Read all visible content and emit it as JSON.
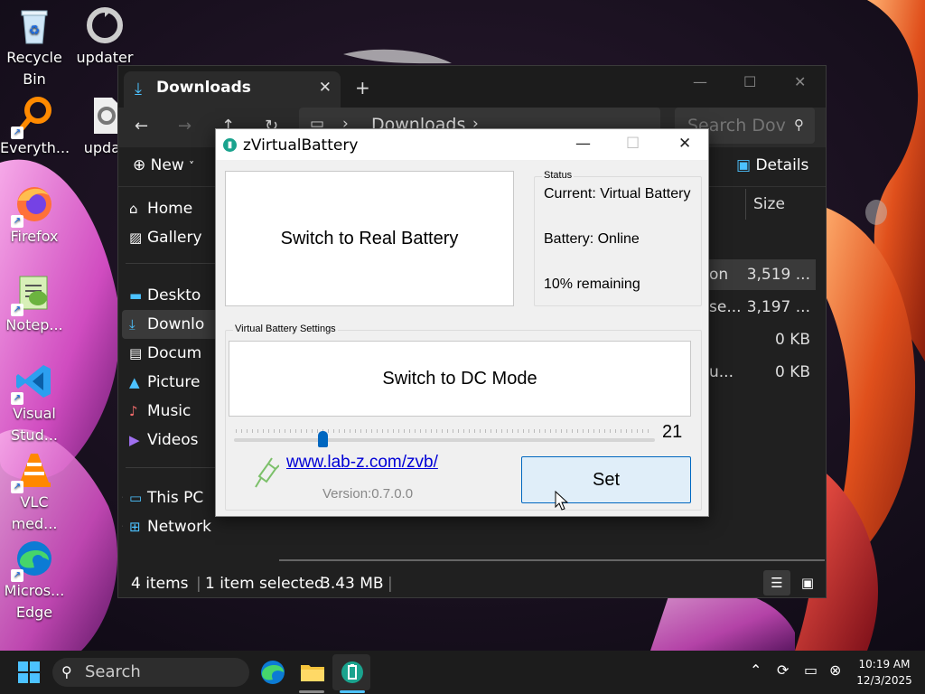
{
  "desktop": {
    "icons": [
      {
        "label": "Recycle\nBin",
        "icon": "recycle-bin-icon"
      },
      {
        "label": "updater",
        "icon": "updater-icon"
      },
      {
        "label": "Everyth...",
        "icon": "everything-search-icon"
      },
      {
        "label": "updat",
        "icon": "gear-file-icon"
      },
      {
        "label": "Firefox",
        "icon": "firefox-icon"
      },
      {
        "label": "Notep...",
        "icon": "notepad-plus-plus-icon"
      },
      {
        "label": "Visual\nStud...",
        "icon": "vscode-icon"
      },
      {
        "label": "VLC\nmed...",
        "icon": "vlc-icon"
      },
      {
        "label": "Micros...\nEdge",
        "icon": "edge-icon"
      }
    ]
  },
  "explorer": {
    "tab_title": "Downloads",
    "tab_close": "✕",
    "new_tab": "+",
    "address": "Downloads",
    "search_placeholder": "Search Dov",
    "new_label": "New",
    "details_label": "Details",
    "sidebar": [
      {
        "label": "Home",
        "icon": "home-icon"
      },
      {
        "label": "Gallery",
        "icon": "gallery-icon"
      },
      {
        "label": "Deskto",
        "icon": "desktop-icon"
      },
      {
        "label": "Downlo",
        "icon": "download-icon"
      },
      {
        "label": "Docum",
        "icon": "documents-icon"
      },
      {
        "label": "Picture",
        "icon": "pictures-icon"
      },
      {
        "label": "Music",
        "icon": "music-icon"
      },
      {
        "label": "Videos",
        "icon": "videos-icon"
      },
      {
        "label": "This PC",
        "icon": "this-pc-icon"
      },
      {
        "label": "Network",
        "icon": "network-icon"
      }
    ],
    "column_size": "Size",
    "files": [
      {
        "name_frag": "on",
        "size": "3,519 ..."
      },
      {
        "name_frag": "se...",
        "size": "3,197 ..."
      },
      {
        "name_frag": "",
        "size": "0 KB"
      },
      {
        "name_frag": "u...",
        "size": "0 KB"
      }
    ],
    "status_items": "4 items",
    "status_selected": "1 item selected",
    "status_size": "3.43 MB"
  },
  "zvb": {
    "title": "zVirtualBattery",
    "switch_real_label": "Switch to Real Battery",
    "status_legend": "Status",
    "status_current": "Current: Virtual Battery",
    "status_battery": "Battery: Online",
    "status_remaining": "10% remaining",
    "settings_legend": "Virtual Battery Settings",
    "switch_dc_label": "Switch to DC Mode",
    "slider_value": "21",
    "slider_percent": 21,
    "link": "www.lab-z.com/zvb/",
    "version": "Version:0.7.0.0",
    "set_label": "Set"
  },
  "taskbar": {
    "search_label": "Search",
    "time": "10:19 AM",
    "date": "12/3/2025"
  }
}
